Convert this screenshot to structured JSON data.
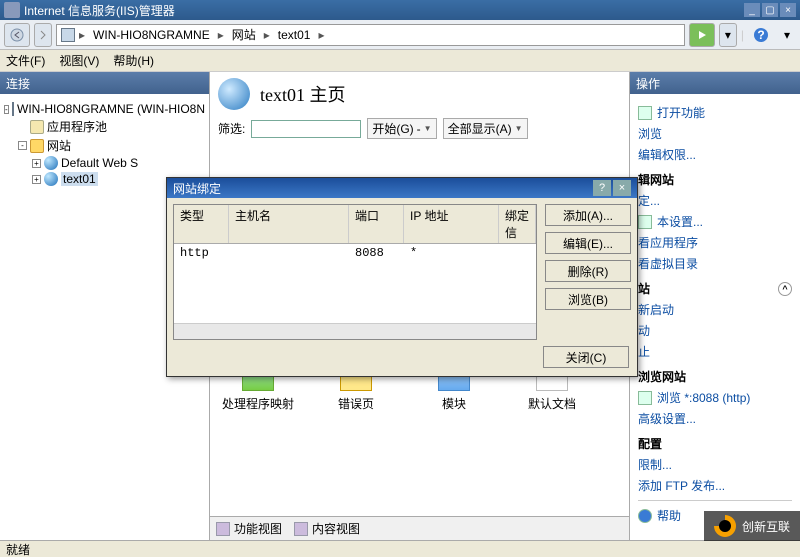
{
  "window": {
    "title": "Internet 信息服务(IIS)管理器"
  },
  "breadcrumb": {
    "segments": [
      "WIN-HIO8NGRAMNE",
      "网站",
      "text01"
    ]
  },
  "menu": {
    "file": "文件(F)",
    "view": "视图(V)",
    "help": "帮助(H)"
  },
  "left": {
    "header": "连接",
    "root": "WIN-HIO8NGRAMNE (WIN-HIO8N",
    "appPools": "应用程序池",
    "sites": "网站",
    "site1": "Default Web S",
    "site2": "text01"
  },
  "center": {
    "title": "text01 主页",
    "filter_label": "筛选:",
    "start_label": "开始(G)",
    "showall_label": "全部显示(A)",
    "grid": {
      "i1": "处理程序映射",
      "i2": "错误页",
      "i3": "模块",
      "i4": "默认文档"
    },
    "view_features": "功能视图",
    "view_content": "内容视图"
  },
  "right": {
    "header": "操作",
    "open_features": "打开功能",
    "browse": "浏览",
    "edit_perm": "编辑权限...",
    "sec_edit_site": "辑网站",
    "bindings": "定...",
    "basic": "本设置...",
    "view_apps": "看应用程序",
    "view_vd": "看虚拟目录",
    "sec_site": "站",
    "restart": "新启动",
    "start": "动",
    "stop": "止",
    "sec_browse": "浏览网站",
    "browse_8088": "浏览 *:8088 (http)",
    "adv": "高级设置...",
    "sec_config": "配置",
    "limits": "限制...",
    "add_ftp": "添加 FTP 发布...",
    "help": "帮助"
  },
  "dialog": {
    "title": "网站绑定",
    "cols": {
      "type": "类型",
      "host": "主机名",
      "port": "端口",
      "ip": "IP 地址",
      "bind": "绑定信"
    },
    "row": {
      "type": "http",
      "host": "",
      "port": "8088",
      "ip": "*"
    },
    "btn_add": "添加(A)...",
    "btn_edit": "编辑(E)...",
    "btn_del": "删除(R)",
    "btn_browse": "浏览(B)",
    "btn_close": "关闭(C)"
  },
  "status": {
    "ready": "就绪"
  },
  "watermark": {
    "text": "创新互联"
  }
}
